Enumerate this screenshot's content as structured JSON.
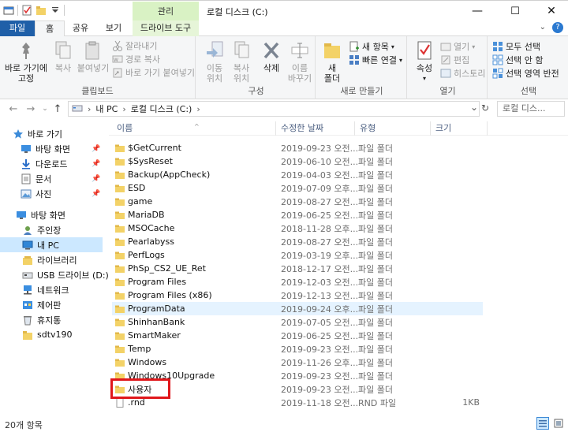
{
  "window": {
    "title": "로컬 디스크 (C:)",
    "context_tab": "관리",
    "minimize": "—",
    "maximize": "☐",
    "close": "✕"
  },
  "tabs": [
    {
      "label": "파일"
    },
    {
      "label": "홈"
    },
    {
      "label": "공유"
    },
    {
      "label": "보기"
    },
    {
      "label": "드라이브 도구"
    }
  ],
  "ribbon": {
    "clipboard": {
      "label": "클립보드",
      "pin_line1": "바로 가기에",
      "pin_line2": "고정",
      "copy": "복사",
      "paste": "붙여넣기",
      "cut": "잘라내기",
      "copy_path": "경로 복사",
      "paste_shortcut": "바로 가기 붙여넣기"
    },
    "organize": {
      "label": "구성",
      "move_line1": "이동",
      "move_line2": "위치",
      "copy_line1": "복사",
      "copy_line2": "위치",
      "delete": "삭제",
      "rename_line1": "이름",
      "rename_line2": "바꾸기"
    },
    "new": {
      "label": "새로 만들기",
      "folder_line1": "새",
      "folder_line2": "폴더",
      "new_item": "새 항목",
      "easy_access": "빠른 연결"
    },
    "open": {
      "label": "열기",
      "properties": "속성",
      "open": "열기",
      "edit": "편집",
      "history": "히스토리"
    },
    "select": {
      "label": "선택",
      "select_all": "모두 선택",
      "select_none": "선택 안 함",
      "invert": "선택 영역 반전"
    }
  },
  "address": {
    "path": [
      "내 PC",
      "로컬 디스크 (C:)"
    ],
    "search_placeholder": "로컬 디스..."
  },
  "nav": {
    "quick_access": "바로 가기",
    "quick_items": [
      "바탕 화면",
      "다운로드",
      "문서",
      "사진"
    ],
    "desktop": "바탕 화면",
    "desktop_items": [
      "주인장",
      "내 PC",
      "라이브러리",
      "USB 드라이브 (D:)",
      "네트워크",
      "제어판",
      "휴지통",
      "sdtv190"
    ]
  },
  "columns": {
    "name": "이름",
    "modified": "수정한 날짜",
    "type": "유형",
    "size": "크기"
  },
  "files": [
    {
      "name": "$GetCurrent",
      "date": "2019-09-23 오전...",
      "type": "파일 폴더",
      "size": ""
    },
    {
      "name": "$SysReset",
      "date": "2019-06-10 오전...",
      "type": "파일 폴더",
      "size": ""
    },
    {
      "name": "Backup(AppCheck)",
      "date": "2019-04-03 오전...",
      "type": "파일 폴더",
      "size": ""
    },
    {
      "name": "ESD",
      "date": "2019-07-09 오후...",
      "type": "파일 폴더",
      "size": ""
    },
    {
      "name": "game",
      "date": "2019-08-27 오전...",
      "type": "파일 폴더",
      "size": ""
    },
    {
      "name": "MariaDB",
      "date": "2019-06-25 오전...",
      "type": "파일 폴더",
      "size": ""
    },
    {
      "name": "MSOCache",
      "date": "2018-11-28 오후...",
      "type": "파일 폴더",
      "size": ""
    },
    {
      "name": "Pearlabyss",
      "date": "2019-08-27 오전...",
      "type": "파일 폴더",
      "size": ""
    },
    {
      "name": "PerfLogs",
      "date": "2019-03-19 오후...",
      "type": "파일 폴더",
      "size": ""
    },
    {
      "name": "PhSp_CS2_UE_Ret",
      "date": "2018-12-17 오전...",
      "type": "파일 폴더",
      "size": ""
    },
    {
      "name": "Program Files",
      "date": "2019-12-03 오전...",
      "type": "파일 폴더",
      "size": ""
    },
    {
      "name": "Program Files (x86)",
      "date": "2019-12-13 오전...",
      "type": "파일 폴더",
      "size": ""
    },
    {
      "name": "ProgramData",
      "date": "2019-09-24 오후...",
      "type": "파일 폴더",
      "size": ""
    },
    {
      "name": "ShinhanBank",
      "date": "2019-07-05 오전...",
      "type": "파일 폴더",
      "size": ""
    },
    {
      "name": "SmartMaker",
      "date": "2019-06-25 오전...",
      "type": "파일 폴더",
      "size": ""
    },
    {
      "name": "Temp",
      "date": "2019-09-23 오전...",
      "type": "파일 폴더",
      "size": ""
    },
    {
      "name": "Windows",
      "date": "2019-11-26 오후...",
      "type": "파일 폴더",
      "size": ""
    },
    {
      "name": "Windows10Upgrade",
      "date": "2019-09-23 오전...",
      "type": "파일 폴더",
      "size": ""
    },
    {
      "name": "사용자",
      "date": "2019-09-23 오전...",
      "type": "파일 폴더",
      "size": ""
    },
    {
      "name": ".rnd",
      "date": "2019-11-18 오전...",
      "type": "RND 파일",
      "size": "1KB"
    }
  ],
  "status": {
    "count": "20개 항목"
  },
  "colors": {
    "file_tab": "#1f5fa8",
    "manage_tab": "#d9f2c4",
    "selection": "#cce8ff",
    "hover_row": "#e5f3ff",
    "highlight_box": "#e0171b",
    "folder": "#f3d267"
  }
}
